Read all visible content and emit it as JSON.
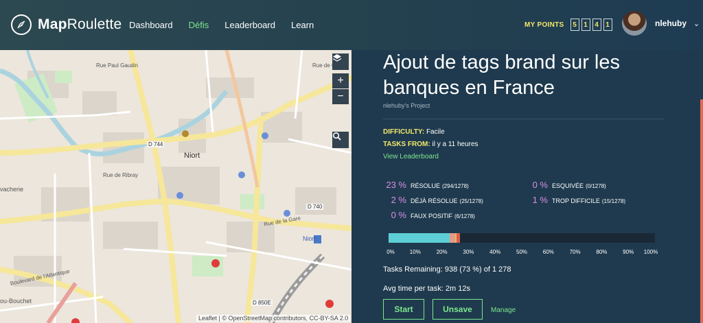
{
  "nav": {
    "brand_bold": "Map",
    "brand_rest": "Roulette",
    "links": [
      {
        "label": "Dashboard",
        "active": false
      },
      {
        "label": "Défis",
        "active": true
      },
      {
        "label": "Leaderboard",
        "active": false
      },
      {
        "label": "Learn",
        "active": false
      }
    ],
    "points_label": "MY POINTS",
    "points_digits": [
      "5",
      "1",
      "4",
      "1"
    ],
    "username": "nlehuby",
    "caret": "⌄"
  },
  "map": {
    "controls": {
      "layers": "layers-icon",
      "zoom_in": "+",
      "zoom_out": "−",
      "search": "search-icon"
    },
    "labels": [
      "Niort",
      "Niort",
      "Boulevard de l'Atlantique",
      "D 744",
      "D 740",
      "D 850E",
      "Rue de la Gare",
      "Rue de Ribray",
      "vacherie",
      "ou-Bouchet",
      "Rue Paul Gaudin",
      "Rue de Goise"
    ],
    "attribution": "Leaflet | © OpenStreetMap contributors, CC-BY-SA 2.0"
  },
  "challenge": {
    "title": "Ajout de tags brand sur les banques en France",
    "owner": "nlehuby's Project",
    "difficulty_label": "DIFFICULTY:",
    "difficulty_value": "Facile",
    "tasks_from_label": "TASKS FROM:",
    "tasks_from_value": "il y a 11 heures",
    "leaderboard_link": "View Leaderboard"
  },
  "stats": [
    {
      "pct": "23 %",
      "label": "RÉSOLUE",
      "count": "(294/1278)"
    },
    {
      "pct": "2 %",
      "label": "DÉJÀ RÉSOLUE",
      "count": "(25/1278)"
    },
    {
      "pct": "0 %",
      "label": "FAUX POSITIF",
      "count": "(6/1278)"
    },
    {
      "pct": "0 %",
      "label": "ESQUIVÉE",
      "count": "(0/1278)"
    },
    {
      "pct": "1 %",
      "label": "TROP DIFFICILE",
      "count": "(15/1278)"
    }
  ],
  "progress": {
    "segments": [
      {
        "name": "resolue",
        "fraction": 0.23,
        "color": "#5ecfd6"
      },
      {
        "name": "deja-resolue",
        "fraction": 0.02,
        "color": "#e39a86"
      },
      {
        "name": "faux-positif",
        "fraction": 0.005,
        "color": "#d6c06a"
      },
      {
        "name": "trop-difficile",
        "fraction": 0.012,
        "color": "#e05b4c"
      }
    ],
    "ticks": [
      "0%",
      "10%",
      "20%",
      "30%",
      "40%",
      "50%",
      "60%",
      "70%",
      "80%",
      "90%",
      "100%"
    ]
  },
  "remaining": "Tasks Remaining: 938 (73 %) of 1 278",
  "avg_time": "Avg time per task:  2m 12s",
  "buttons": {
    "start": "Start",
    "unsave": "Unsave",
    "manage": "Manage"
  }
}
